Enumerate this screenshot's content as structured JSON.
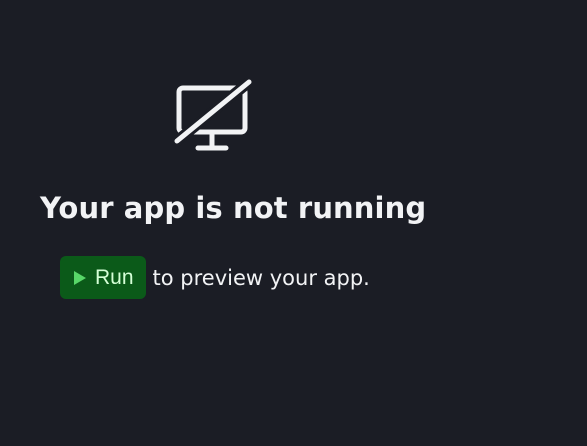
{
  "empty_state": {
    "icon": "monitor-off-icon",
    "heading": "Your app is not running",
    "run_button": {
      "icon": "play-icon",
      "label": "Run"
    },
    "message_suffix": "to preview your app."
  },
  "colors": {
    "background": "#1b1d25",
    "text": "#f2f3f5",
    "run_button_background": "#0b5a19",
    "run_button_text": "#d5ffd7",
    "play_icon": "#58d768"
  }
}
